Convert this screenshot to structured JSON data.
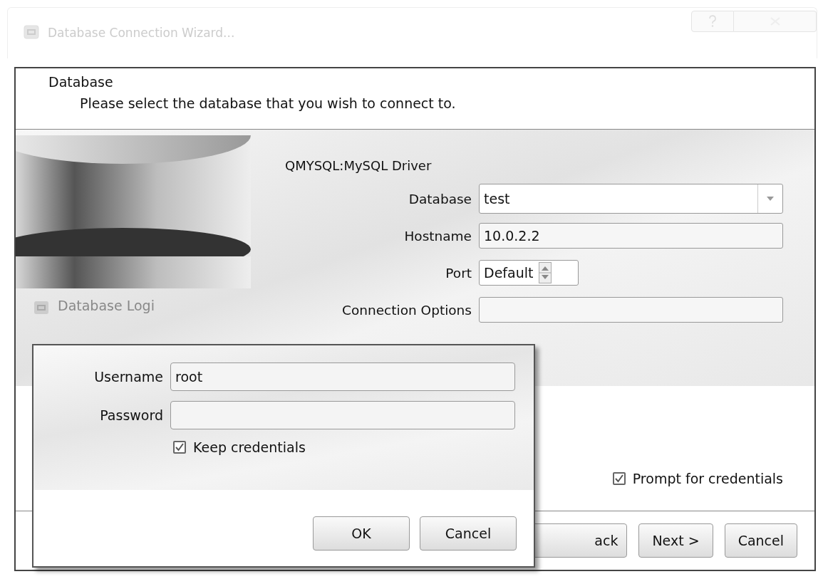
{
  "window": {
    "title": "Database Connection Wizard..."
  },
  "page": {
    "title": "Database",
    "subtitle": "Please select the database that you wish to connect to."
  },
  "driver": "QMYSQL:MySQL Driver",
  "fields": [
    {
      "kind": "combo",
      "label": "Database",
      "value": "test"
    },
    {
      "kind": "text",
      "label": "Hostname",
      "value": "10.0.2.2"
    },
    {
      "kind": "spin",
      "label": "Port",
      "value": "Default"
    },
    {
      "kind": "text",
      "label": "Connection Options"
    }
  ],
  "prompt_checkbox": {
    "label": "Prompt for credentials",
    "checked": true
  },
  "buttons": [
    {
      "label": "ack",
      "disabled": false
    },
    {
      "label": "Next >",
      "disabled": false
    },
    {
      "label": "Cancel",
      "disabled": false
    }
  ],
  "login": {
    "ghost_title": "Database Logi",
    "fields": [
      {
        "label": "Username",
        "value": "root"
      },
      {
        "label": "Password"
      }
    ],
    "keep_checkbox": {
      "label": "Keep credentials",
      "checked": true
    },
    "buttons": [
      "OK",
      "Cancel"
    ]
  }
}
